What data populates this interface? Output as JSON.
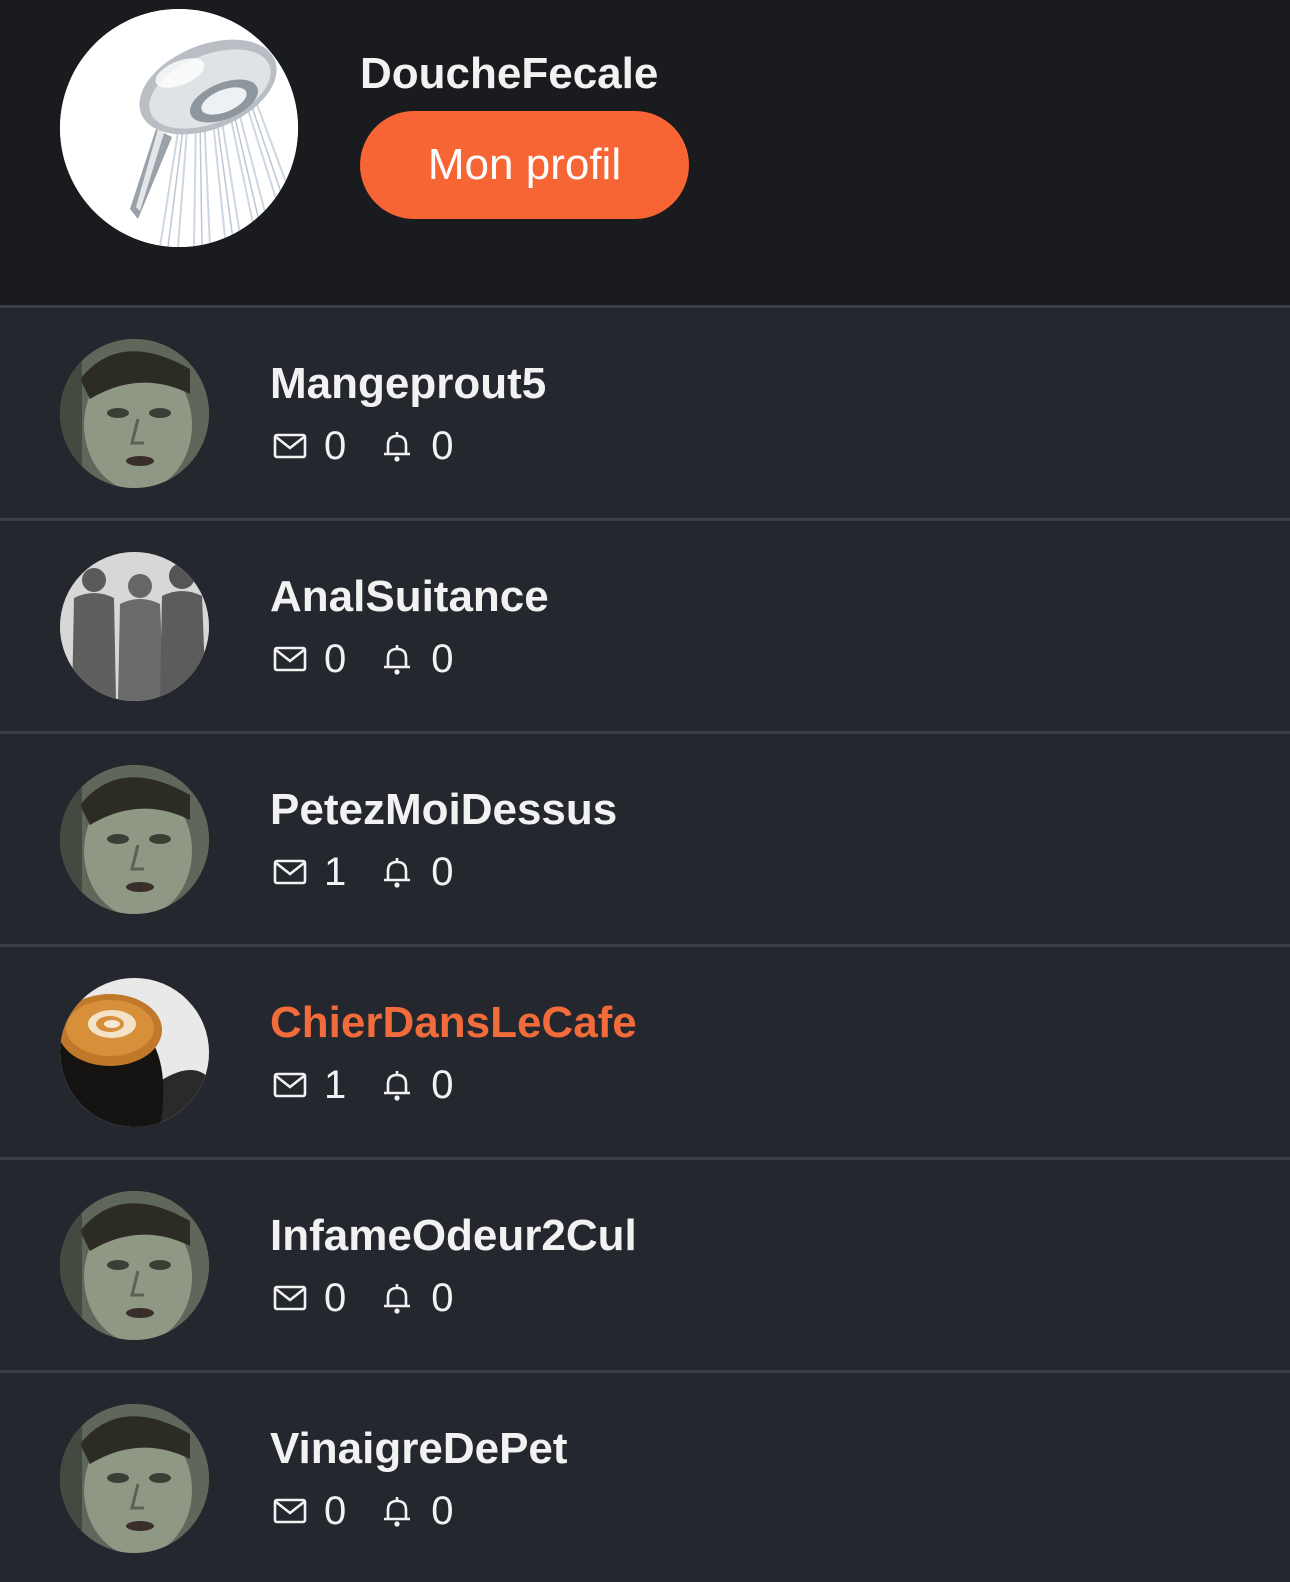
{
  "current_account": {
    "username": "DoucheFecale",
    "avatar": "shower-head-avatar",
    "profile_button_label": "Mon profil"
  },
  "accounts": [
    {
      "username": "Mangeprout5",
      "avatar": "face-avatar",
      "messages": "0",
      "notifications": "0",
      "active": false
    },
    {
      "username": "AnalSuitance",
      "avatar": "silhouettes-avatar",
      "messages": "0",
      "notifications": "0",
      "active": false
    },
    {
      "username": "PetezMoiDessus",
      "avatar": "face-avatar",
      "messages": "1",
      "notifications": "0",
      "active": false
    },
    {
      "username": "ChierDansLeCafe",
      "avatar": "coffee-cup-avatar",
      "messages": "1",
      "notifications": "0",
      "active": true
    },
    {
      "username": "InfameOdeur2Cul",
      "avatar": "face-avatar",
      "messages": "0",
      "notifications": "0",
      "active": false
    },
    {
      "username": "VinaigreDePet",
      "avatar": "face-avatar",
      "messages": "0",
      "notifications": "0",
      "active": false
    }
  ],
  "icons": {
    "messages": "envelope-icon",
    "notifications": "bell-icon"
  },
  "colors": {
    "accent": "#f66533",
    "active_name": "#f26b3a",
    "header_background": "#1a1b1f",
    "list_background": "#25272f",
    "divider": "#3b3e47",
    "text": "#f2f2f2"
  }
}
